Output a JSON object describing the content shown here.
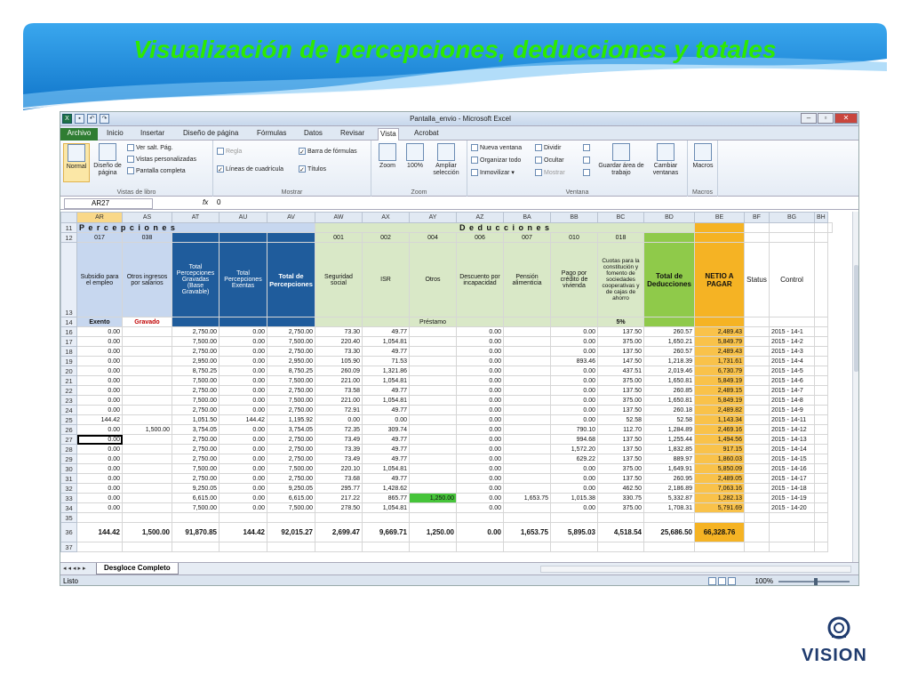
{
  "slide_title": "Visualización de percepciones, deducciones y totales",
  "window": {
    "title": "Pantalla_envio  -  Microsoft Excel"
  },
  "tabs": [
    "Archivo",
    "Inicio",
    "Insertar",
    "Diseño de página",
    "Fórmulas",
    "Datos",
    "Revisar",
    "Vista",
    "Acrobat"
  ],
  "ribbon": {
    "normal": "Normal",
    "page_layout": "Diseño de página",
    "page_break": "Ver salt. Pág.",
    "custom_views": "Vistas personalizadas",
    "full_screen": "Pantalla completa",
    "group_book_views": "Vistas de libro",
    "ruler": "Regla",
    "formula_bar": "Barra de fórmulas",
    "gridlines": "Líneas de cuadrícula",
    "headings": "Títulos",
    "group_show": "Mostrar",
    "zoom": "Zoom",
    "zoom100": "100%",
    "zoom_selection": "Ampliar selección",
    "group_zoom": "Zoom",
    "new_window": "Nueva ventana",
    "arrange_all": "Organizar todo",
    "freeze": "Inmovilizar",
    "split": "Dividir",
    "hide": "Ocultar",
    "unhide": "Mostrar",
    "save_workspace": "Guardar área de trabajo",
    "switch_windows": "Cambiar ventanas",
    "group_window": "Ventana",
    "macros": "Macros",
    "group_macros": "Macros"
  },
  "formula_bar": {
    "name_box": "AR27",
    "fx": "fx",
    "value": "0"
  },
  "columns": [
    "AR",
    "AS",
    "AT",
    "AU",
    "AV",
    "AW",
    "AX",
    "AY",
    "AZ",
    "BA",
    "BB",
    "BC",
    "BD",
    "BE",
    "BF",
    "BG",
    "BH"
  ],
  "header": {
    "percepciones": "P e r c e p c i o n e s",
    "deducciones": "D e d u c c i o n e s",
    "codes": [
      "017",
      "038",
      "",
      "",
      "",
      "001",
      "002",
      "004",
      "006",
      "007",
      "010",
      "018"
    ],
    "desc": [
      "Subsidio para el empleo",
      "Otros ingresos por salarios",
      "Total Percepciones Gravadas (Base Gravable)",
      "Total Percepciones Exentas",
      "Total de Percepciones",
      "Seguridad social",
      "ISR",
      "Otros",
      "Descuento por incapacidad",
      "Pensión alimenticia",
      "Pago por crédito de vivienda",
      "Cuotas para la constitución y fomento de sociedades cooperativas y de cajas de ahorro",
      "Total de Deducciones",
      "NETIO A PAGAR",
      "Status",
      "Control"
    ],
    "row14": {
      "exento": "Exento",
      "gravado": "Gravado",
      "prestamo": "Préstamo",
      "pct": "5%"
    }
  },
  "rows": [
    {
      "n": "16",
      "v": [
        "0.00",
        "",
        "2,750.00",
        "0.00",
        "2,750.00",
        "73.30",
        "49.77",
        "",
        "0.00",
        "",
        "0.00",
        "137.50",
        "260.57",
        "2,489.43",
        "",
        "2015 - 14-1"
      ]
    },
    {
      "n": "17",
      "v": [
        "0.00",
        "",
        "7,500.00",
        "0.00",
        "7,500.00",
        "220.40",
        "1,054.81",
        "",
        "0.00",
        "",
        "0.00",
        "375.00",
        "1,650.21",
        "5,849.79",
        "",
        "2015 - 14-2"
      ]
    },
    {
      "n": "18",
      "v": [
        "0.00",
        "",
        "2,750.00",
        "0.00",
        "2,750.00",
        "73.30",
        "49.77",
        "",
        "0.00",
        "",
        "0.00",
        "137.50",
        "260.57",
        "2,489.43",
        "",
        "2015 - 14-3"
      ]
    },
    {
      "n": "19",
      "v": [
        "0.00",
        "",
        "2,950.00",
        "0.00",
        "2,950.00",
        "105.90",
        "71.53",
        "",
        "0.00",
        "",
        "893.46",
        "147.50",
        "1,218.39",
        "1,731.61",
        "",
        "2015 - 14-4"
      ]
    },
    {
      "n": "20",
      "v": [
        "0.00",
        "",
        "8,750.25",
        "0.00",
        "8,750.25",
        "260.09",
        "1,321.86",
        "",
        "0.00",
        "",
        "0.00",
        "437.51",
        "2,019.46",
        "6,730.79",
        "",
        "2015 - 14-5"
      ]
    },
    {
      "n": "21",
      "v": [
        "0.00",
        "",
        "7,500.00",
        "0.00",
        "7,500.00",
        "221.00",
        "1,054.81",
        "",
        "0.00",
        "",
        "0.00",
        "375.00",
        "1,650.81",
        "5,849.19",
        "",
        "2015 - 14-6"
      ]
    },
    {
      "n": "22",
      "v": [
        "0.00",
        "",
        "2,750.00",
        "0.00",
        "2,750.00",
        "73.58",
        "49.77",
        "",
        "0.00",
        "",
        "0.00",
        "137.50",
        "260.85",
        "2,489.15",
        "",
        "2015 - 14-7"
      ]
    },
    {
      "n": "23",
      "v": [
        "0.00",
        "",
        "7,500.00",
        "0.00",
        "7,500.00",
        "221.00",
        "1,054.81",
        "",
        "0.00",
        "",
        "0.00",
        "375.00",
        "1,650.81",
        "5,849.19",
        "",
        "2015 - 14-8"
      ]
    },
    {
      "n": "24",
      "v": [
        "0.00",
        "",
        "2,750.00",
        "0.00",
        "2,750.00",
        "72.91",
        "49.77",
        "",
        "0.00",
        "",
        "0.00",
        "137.50",
        "260.18",
        "2,489.82",
        "",
        "2015 - 14-9"
      ]
    },
    {
      "n": "25",
      "v": [
        "144.42",
        "",
        "1,051.50",
        "144.42",
        "1,195.92",
        "0.00",
        "0.00",
        "",
        "0.00",
        "",
        "0.00",
        "52.58",
        "52.58",
        "1,143.34",
        "",
        "2015 - 14-11"
      ]
    },
    {
      "n": "26",
      "v": [
        "0.00",
        "1,500.00",
        "3,754.05",
        "0.00",
        "3,754.05",
        "72.35",
        "309.74",
        "",
        "0.00",
        "",
        "790.10",
        "112.70",
        "1,284.89",
        "2,469.16",
        "",
        "2015 - 14-12"
      ]
    },
    {
      "n": "27",
      "v": [
        "0.00",
        "",
        "2,750.00",
        "0.00",
        "2,750.00",
        "73.49",
        "49.77",
        "",
        "0.00",
        "",
        "994.68",
        "137.50",
        "1,255.44",
        "1,494.56",
        "",
        "2015 - 14-13"
      ]
    },
    {
      "n": "28",
      "v": [
        "0.00",
        "",
        "2,750.00",
        "0.00",
        "2,750.00",
        "73.39",
        "49.77",
        "",
        "0.00",
        "",
        "1,572.20",
        "137.50",
        "1,832.85",
        "917.15",
        "",
        "2015 - 14-14"
      ]
    },
    {
      "n": "29",
      "v": [
        "0.00",
        "",
        "2,750.00",
        "0.00",
        "2,750.00",
        "73.49",
        "49.77",
        "",
        "0.00",
        "",
        "629.22",
        "137.50",
        "889.97",
        "1,860.03",
        "",
        "2015 - 14-15"
      ]
    },
    {
      "n": "30",
      "v": [
        "0.00",
        "",
        "7,500.00",
        "0.00",
        "7,500.00",
        "220.10",
        "1,054.81",
        "",
        "0.00",
        "",
        "0.00",
        "375.00",
        "1,649.91",
        "5,850.09",
        "",
        "2015 - 14-16"
      ]
    },
    {
      "n": "31",
      "v": [
        "0.00",
        "",
        "2,750.00",
        "0.00",
        "2,750.00",
        "73.68",
        "49.77",
        "",
        "0.00",
        "",
        "0.00",
        "137.50",
        "260.95",
        "2,489.05",
        "",
        "2015 - 14-17"
      ]
    },
    {
      "n": "32",
      "v": [
        "0.00",
        "",
        "9,250.05",
        "0.00",
        "9,250.05",
        "295.77",
        "1,428.62",
        "",
        "0.00",
        "",
        "0.00",
        "462.50",
        "2,186.89",
        "7,063.16",
        "",
        "2015 - 14-18"
      ]
    },
    {
      "n": "33",
      "v": [
        "0.00",
        "",
        "6,615.00",
        "0.00",
        "6,615.00",
        "217.22",
        "865.77",
        "1,250.00",
        "0.00",
        "1,653.75",
        "1,015.38",
        "330.75",
        "5,332.87",
        "1,282.13",
        "",
        "2015 - 14-19"
      ]
    },
    {
      "n": "34",
      "v": [
        "0.00",
        "",
        "7,500.00",
        "0.00",
        "7,500.00",
        "278.50",
        "1,054.81",
        "",
        "0.00",
        "",
        "0.00",
        "375.00",
        "1,708.31",
        "5,791.69",
        "",
        "2015 - 14-20"
      ]
    }
  ],
  "totals": {
    "n": "36",
    "v": [
      "144.42",
      "1,500.00",
      "91,870.85",
      "144.42",
      "92,015.27",
      "2,699.47",
      "9,669.71",
      "1,250.00",
      "0.00",
      "1,653.75",
      "5,895.03",
      "4,518.54",
      "25,686.50",
      "66,328.76",
      "",
      ""
    ]
  },
  "sheet_tab": "Desgloce Completo",
  "status": {
    "text": "Listo",
    "zoom": "100%"
  },
  "logo": {
    "text": "VISION",
    "color": "#1f3b6e"
  },
  "colors": {
    "title": "#2eea00",
    "banner": "#1a8fe0",
    "net_pay": "#f5b324",
    "deductions_total": "#8fca4a",
    "perceptions_header": "#1f5c9c"
  }
}
